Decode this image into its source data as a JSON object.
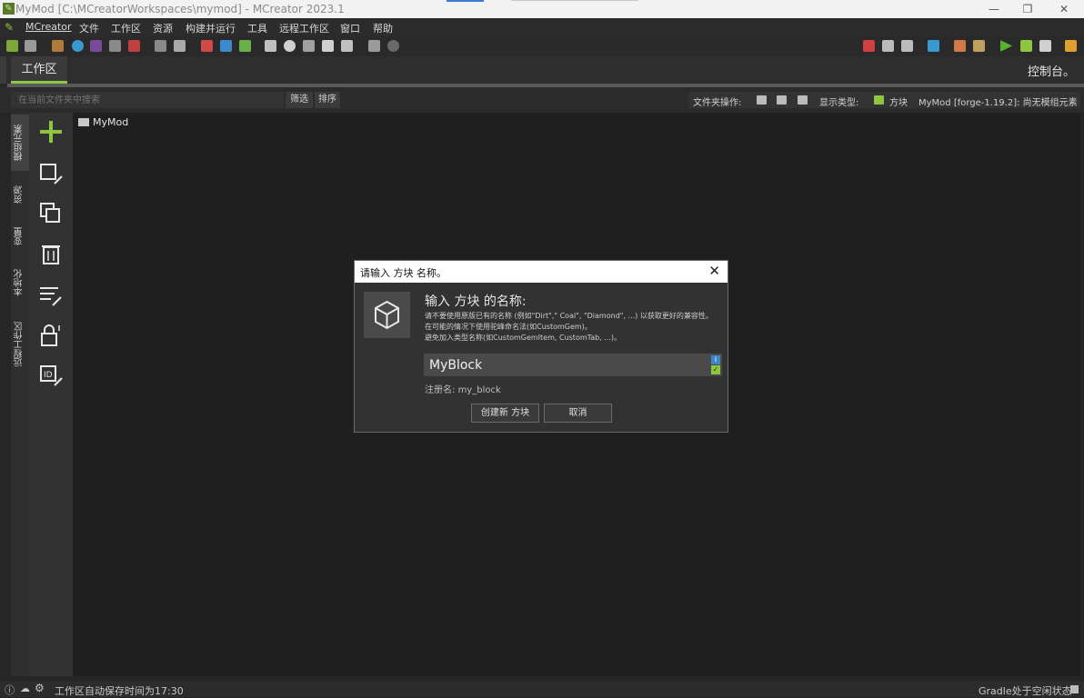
{
  "window": {
    "title": "MyMod [C:\\MCreatorWorkspaces\\mymod] - MCreator 2023.1",
    "app_icon": "mcreator-logo-icon"
  },
  "menu": {
    "items": [
      "MCreator",
      "文件",
      "工作区",
      "资源",
      "构建并运行",
      "工具",
      "远程工作区",
      "窗口",
      "帮助"
    ]
  },
  "tabs": {
    "workspace": "工作区",
    "console": "控制台。"
  },
  "filter": {
    "search_placeholder": "在当前文件夹中搜索",
    "filter_label": "筛选",
    "sort_label": "排序",
    "folder_ops_label": "文件夹操作:",
    "display_type_label": "显示类型:",
    "display_type_value": "方块",
    "mod_info": "MyMod [forge-1.19.2]: 尚无模组元素"
  },
  "vertical_tabs": [
    "模组元素",
    "资源",
    "变量",
    "本地化",
    "远程工作区"
  ],
  "file_tree": {
    "root_folder": "MyMod"
  },
  "status": {
    "autosave": "工作区自动保存时间为17:30",
    "gradle": "Gradle处于空闲状态"
  },
  "dialog": {
    "title": "请输入 方块 名称。",
    "heading": "输入 方块 的名称:",
    "hint_line1": "请不要使用原版已有的名称 (例如\"Dirt\",\" Coal\", \"Diamond\", ...) 以获取更好的兼容性。",
    "hint_line2": "在可能的情况下使用驼峰命名法(如CustomGem)。",
    "hint_line3": "避免加入类型名称(如CustomGemItem, CustomTab, ...)。",
    "name_value": "MyBlock",
    "registry_label": "注册名:",
    "registry_value": "my_block",
    "create_button": "创建新 方块",
    "cancel_button": "取消"
  },
  "colors": {
    "accent": "#8dc63f",
    "background": "#262626",
    "dialog_bg": "#323232"
  }
}
